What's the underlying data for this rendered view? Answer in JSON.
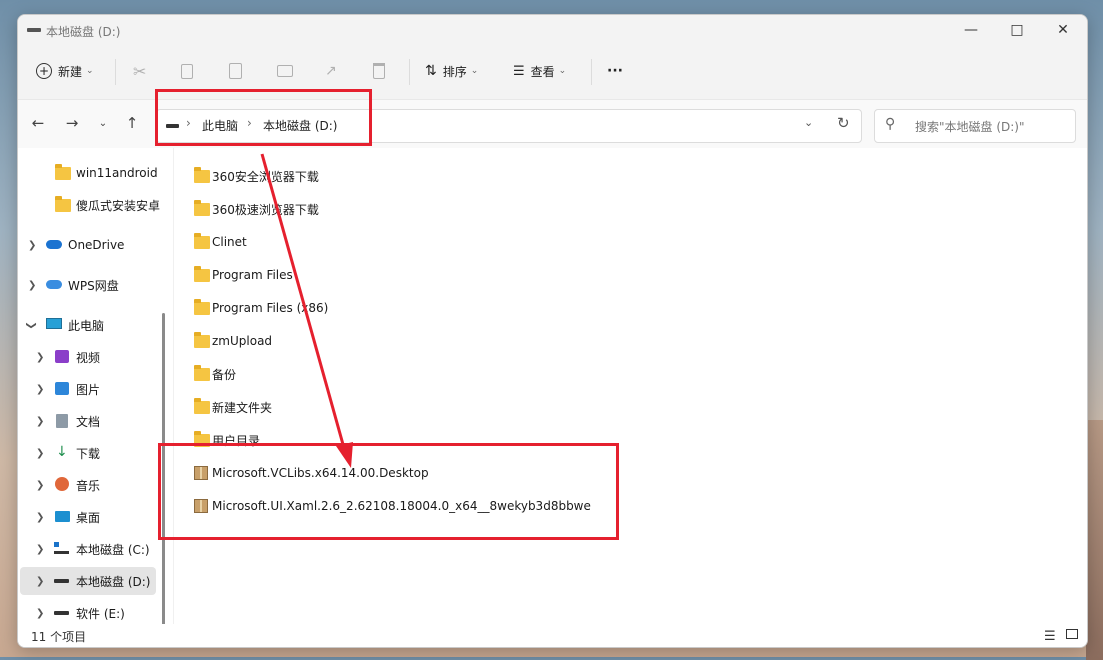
{
  "window": {
    "title": "本地磁盘 (D:)"
  },
  "toolbar": {
    "new_label": "新建",
    "sort_label": "排序",
    "view_label": "查看",
    "more_label": "···"
  },
  "address": {
    "crumbs": [
      "此电脑",
      "本地磁盘 (D:)"
    ],
    "search_placeholder": "搜索\"本地磁盘 (D:)\""
  },
  "sidebar": {
    "items": [
      {
        "label": "win11android",
        "icon": "folder-icon"
      },
      {
        "label": "傻瓜式安装安卓",
        "icon": "folder-icon"
      },
      {
        "label": "OneDrive",
        "icon": "cloud-icon"
      },
      {
        "label": "WPS网盘",
        "icon": "cloud-icon"
      },
      {
        "label": "此电脑",
        "icon": "computer-icon"
      },
      {
        "label": "视频",
        "icon": "video-icon"
      },
      {
        "label": "图片",
        "icon": "picture-icon"
      },
      {
        "label": "文档",
        "icon": "document-icon"
      },
      {
        "label": "下载",
        "icon": "download-icon"
      },
      {
        "label": "音乐",
        "icon": "music-icon"
      },
      {
        "label": "桌面",
        "icon": "desktop-icon"
      },
      {
        "label": "本地磁盘 (C:)",
        "icon": "drive-icon"
      },
      {
        "label": "本地磁盘 (D:)",
        "icon": "drive-icon"
      },
      {
        "label": "软件 (E:)",
        "icon": "drive-icon"
      }
    ]
  },
  "files": [
    {
      "name": "360安全浏览器下载",
      "type": "folder"
    },
    {
      "name": "360极速浏览器下载",
      "type": "folder"
    },
    {
      "name": "Clinet",
      "type": "folder"
    },
    {
      "name": "Program Files",
      "type": "folder"
    },
    {
      "name": "Program Files (x86)",
      "type": "folder"
    },
    {
      "name": "zmUpload",
      "type": "folder"
    },
    {
      "name": "备份",
      "type": "folder"
    },
    {
      "name": "新建文件夹",
      "type": "folder"
    },
    {
      "name": "用户目录",
      "type": "folder"
    },
    {
      "name": "Microsoft.VCLibs.x64.14.00.Desktop",
      "type": "package"
    },
    {
      "name": "Microsoft.UI.Xaml.2.6_2.62108.18004.0_x64__8wekyb3d8bbwe",
      "type": "package"
    }
  ],
  "status": {
    "item_count": "11 个项目"
  },
  "colors": {
    "annotation": "#e5202e",
    "folder": "#f5c542",
    "selection": "#e4e4e4"
  }
}
